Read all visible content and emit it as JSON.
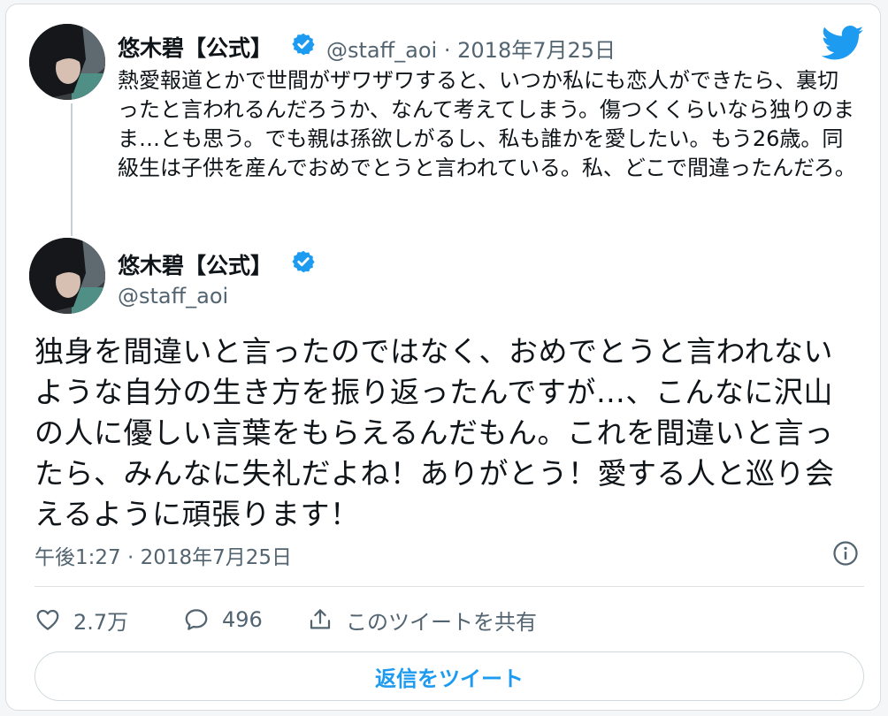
{
  "parent_tweet": {
    "display_name": "悠木碧【公式】",
    "handle": "@staff_aoi",
    "separator": "·",
    "date": "2018年7月25日",
    "text": "熱愛報道とかで世間がザワザワすると、いつか私にも恋人ができたら、裏切ったと言われるんだろうか、なんて考えてしまう。傷つくくらいなら独りのまま…とも思う。でも親は孫欲しがるし、私も誰かを愛したい。もう26歳。同級生は子供を産んでおめでとうと言われている。私、どこで間違ったんだろ。"
  },
  "main_tweet": {
    "display_name": "悠木碧【公式】",
    "handle": "@staff_aoi",
    "text": "独身を間違いと言ったのではなく、おめでとうと言われないような自分の生き方を振り返ったんですが…、こんなに沢山の人に優しい言葉をもらえるんだもん。これを間違いと言ったら、みんなに失礼だよね！ありがとう！愛する人と巡り会えるように頑張ります！",
    "timestamp": "午後1:27 · 2018年7月25日"
  },
  "actions": {
    "likes": "2.7万",
    "replies": "496",
    "share_label": "このツイートを共有"
  },
  "reply_button_label": "返信をツイート",
  "icons": {
    "brand": "twitter-bird-icon",
    "verified": "verified-badge-icon",
    "like": "heart-icon",
    "reply": "speech-bubble-icon",
    "share": "share-icon",
    "info": "info-icon"
  },
  "colors": {
    "brand_blue": "#1d9bf0",
    "text_primary": "#0f1419",
    "text_secondary": "#536471",
    "border": "#cfd9de"
  }
}
